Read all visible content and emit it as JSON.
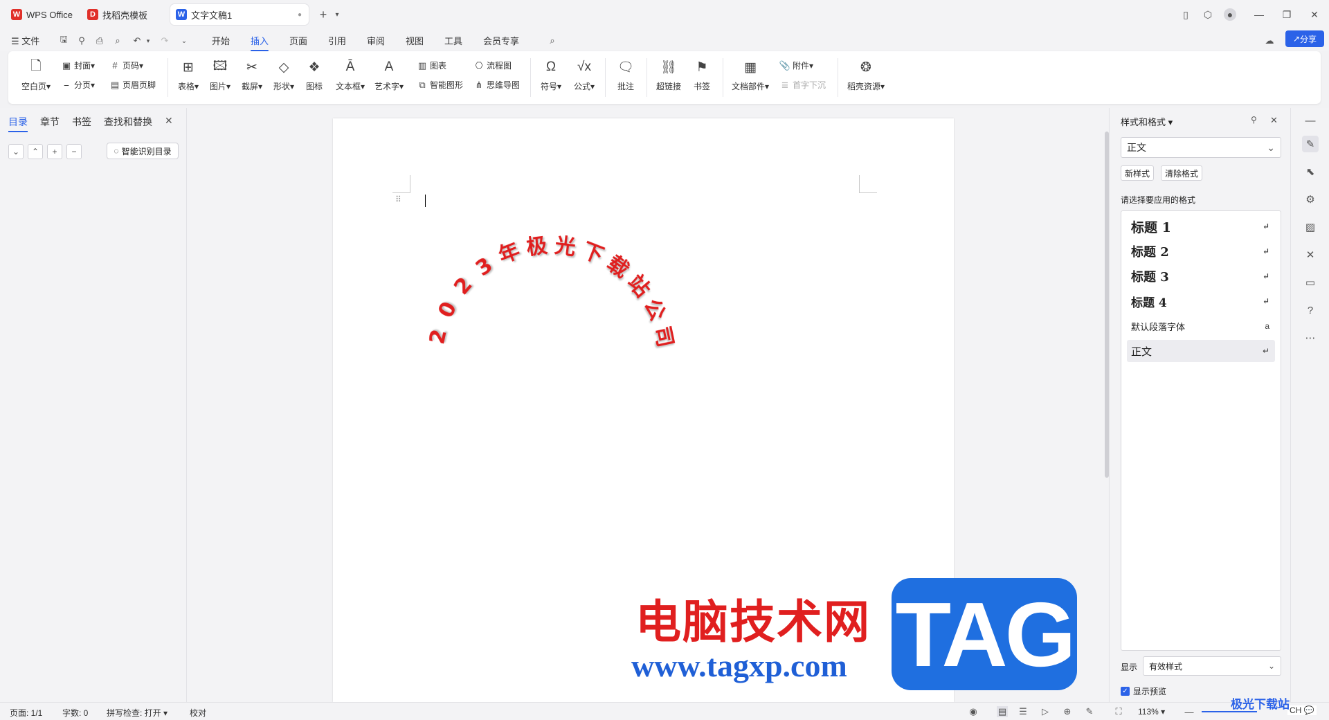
{
  "titlebar": {
    "tabs": [
      {
        "label": "WPS Office",
        "icon": "wps-logo-icon",
        "color": "#e0302a"
      },
      {
        "label": "找稻壳模板",
        "icon": "docer-icon",
        "color": "#e0302a"
      },
      {
        "label": "文字文稿1",
        "icon": "writer-doc-icon",
        "color": "#2b62e8"
      }
    ],
    "new_tab": "+"
  },
  "menu": {
    "file": "文件",
    "tabs": [
      "开始",
      "插入",
      "页面",
      "引用",
      "审阅",
      "视图",
      "工具",
      "会员专享"
    ],
    "active": "插入",
    "share": "分享"
  },
  "ribbon": {
    "blank_page": "空白页",
    "cover": "封面",
    "page_break": "分页",
    "page_number": "页码",
    "header_footer": "页眉页脚",
    "table": "表格",
    "picture": "图片",
    "screenshot": "截屏",
    "shape": "形状",
    "icon": "图标",
    "textbox": "文本框",
    "wordart": "艺术字",
    "chart": "图表",
    "smart_graphic": "智能图形",
    "flowchart": "流程图",
    "mindmap": "思维导图",
    "symbol": "符号",
    "formula": "公式",
    "comment": "批注",
    "hyperlink": "超链接",
    "bookmark": "书签",
    "doc_parts": "文档部件",
    "attachment": "附件",
    "drop_cap": "首字下沉",
    "docer_resources": "稻壳资源"
  },
  "leftpane": {
    "tabs": [
      "目录",
      "章节",
      "书签",
      "查找和替换"
    ],
    "active": "目录",
    "smart_toc": "智能识别目录"
  },
  "document": {
    "arc_text": "2023年极光下载站公司",
    "arc_color": "#e01f1f"
  },
  "watermark": {
    "cn": "电脑技术网",
    "url": "www.tagxp.com",
    "tag": "TAG",
    "corner_site": "极光下载站"
  },
  "rightpane": {
    "title": "样式和格式",
    "current_style": "正文",
    "new_style": "新样式",
    "clear_format": "清除格式",
    "prompt": "请选择要应用的格式",
    "styles": [
      {
        "label": "标题  1",
        "mark": "↵"
      },
      {
        "label": "标题  2",
        "mark": "↵"
      },
      {
        "label": "标题  3",
        "mark": "↵"
      },
      {
        "label": "标题  4",
        "mark": "↵"
      },
      {
        "label": "默认段落字体",
        "mark": "a"
      },
      {
        "label": "正文",
        "mark": "↵"
      }
    ],
    "show_label": "显示",
    "show_value": "有效样式",
    "preview": "显示预览"
  },
  "statusbar": {
    "page": "页面: 1/1",
    "words": "字数: 0",
    "spell": "拼写检查: 打开",
    "proof": "校对",
    "zoom": "113%",
    "input_method": "CH 💬"
  }
}
